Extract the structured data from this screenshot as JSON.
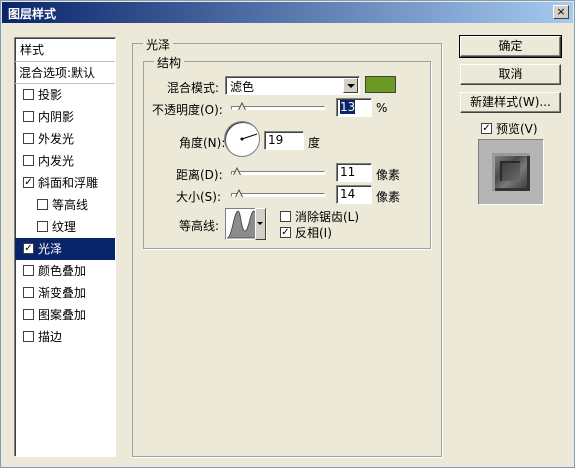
{
  "window": {
    "title": "图层样式",
    "close_glyph": "×"
  },
  "style_list": {
    "header": "样式",
    "blend_options": "混合选项:默认",
    "items": [
      {
        "label": "投影",
        "checked": false
      },
      {
        "label": "内阴影",
        "checked": false
      },
      {
        "label": "外发光",
        "checked": false
      },
      {
        "label": "内发光",
        "checked": false
      },
      {
        "label": "斜面和浮雕",
        "checked": true
      },
      {
        "label": "等高线",
        "checked": false
      },
      {
        "label": "纹理",
        "checked": false
      },
      {
        "label": "光泽",
        "checked": true
      },
      {
        "label": "颜色叠加",
        "checked": false
      },
      {
        "label": "渐变叠加",
        "checked": false
      },
      {
        "label": "图案叠加",
        "checked": false
      },
      {
        "label": "描边",
        "checked": false
      }
    ],
    "selected_item": "光泽"
  },
  "satin": {
    "group_title": "光泽",
    "structure_title": "结构",
    "blend_mode_label": "混合模式:",
    "blend_mode_value": "滤色",
    "blend_color": "#6b9a24",
    "opacity_label": "不透明度(O):",
    "opacity_value": "13",
    "opacity_unit": "%",
    "angle_label": "角度(N):",
    "angle_value": "19",
    "angle_unit": "度",
    "distance_label": "距离(D):",
    "distance_value": "11",
    "distance_unit": "像素",
    "size_label": "大小(S):",
    "size_value": "14",
    "size_unit": "像素",
    "contour_label": "等高线:",
    "antialias_label": "消除锯齿(L)",
    "antialias_checked": false,
    "invert_label": "反相(I)",
    "invert_checked": true
  },
  "buttons": {
    "ok": "确定",
    "cancel": "取消",
    "new_style": "新建样式(W)...",
    "preview_label": "预览(V)",
    "preview_checked": true
  }
}
